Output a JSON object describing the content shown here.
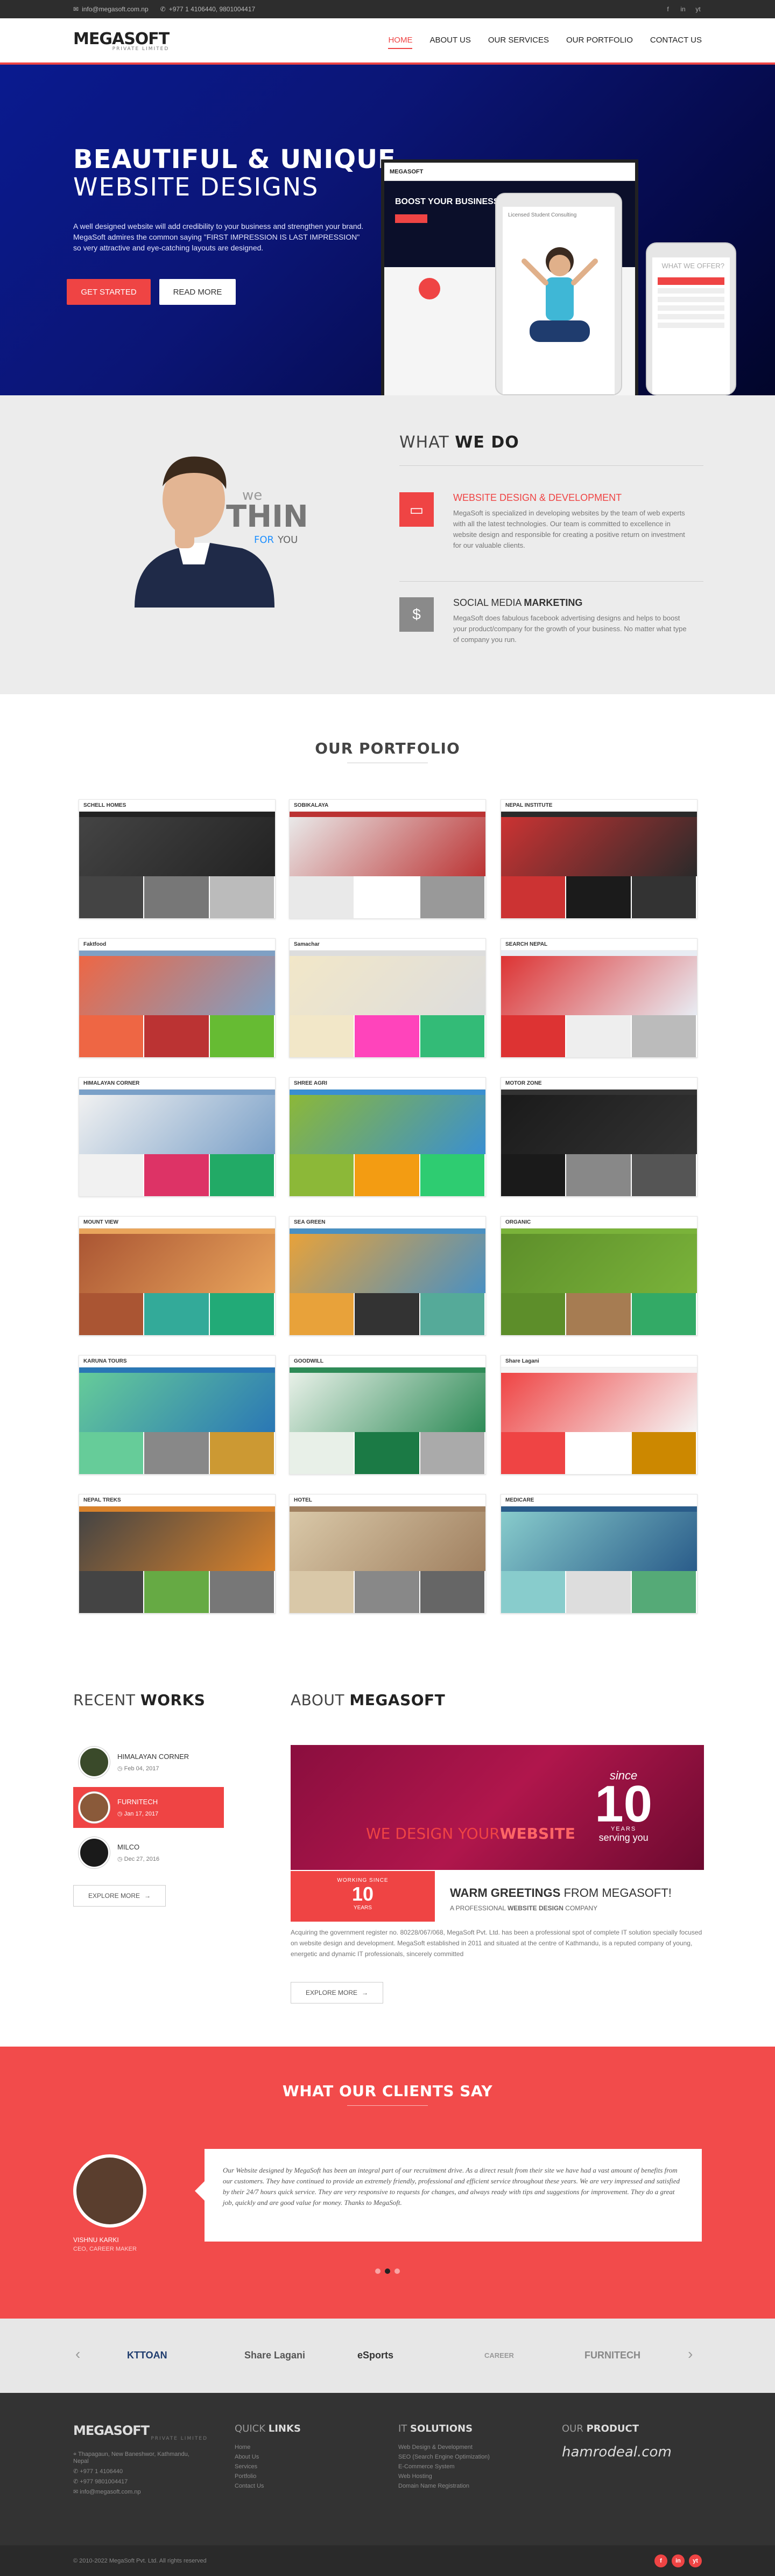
{
  "topbar": {
    "email": "info@megasoft.com.np",
    "phone": "+977 1 4106440, 9801004417",
    "social": [
      "f",
      "in",
      "yt"
    ]
  },
  "nav": {
    "logo_main": "MEGASOFT",
    "logo_sub": "PRIVATE LIMITED",
    "items": [
      "HOME",
      "ABOUT US",
      "OUR SERVICES",
      "OUR PORTFOLIO",
      "CONTACT US"
    ],
    "active": "HOME"
  },
  "hero": {
    "title_bold": "BEAUTIFUL & UNIQUE",
    "title_light": "WEBSITE DESIGNS",
    "text": "A well designed website will add credibility to your business and strengthen your brand. MegaSoft admires the common saying \"FIRST IMPRESSION IS LAST IMPRESSION\" so very attractive and eye-catching layouts are designed.",
    "btn_primary": "GET STARTED",
    "btn_secondary": "READ MORE",
    "laptop_heading": "BOOST YOUR BUSINESS WITH MEGASOFT",
    "laptop_logo": "MEGASOFT",
    "tablet_label": "Licensed Student Consulting",
    "phone_title": "WHAT WE OFFER?"
  },
  "whatwe": {
    "title_light": "WHAT",
    "title_bold": "WE DO",
    "think_we": "we",
    "think_big": "THINK",
    "think_for": "FOR",
    "think_you": "YOU",
    "items": [
      {
        "title_red": "WEBSITE DESIGN",
        "title_rest": "& DEVELOPMENT",
        "text": "MegaSoft is specialized in developing websites by the team of web experts with all the latest technologies. Our team is committed to excellence in website design and responsible for creating a positive return on investment for our valuable clients.",
        "icon": "monitor-icon",
        "color": "#ef4444"
      },
      {
        "title_red": "SOCIAL MEDIA",
        "title_rest": "MARKETING",
        "text": "MegaSoft does fabulous facebook advertising designs and helps to boost your product/company for the growth of your business. No matter what type of company you run.",
        "icon": "dollar-icon",
        "color": "#8a8a8a"
      }
    ]
  },
  "portfolio": {
    "title": "OUR PORTFOLIO",
    "items": [
      {
        "label": "SCHELL HOMES",
        "colors": [
          "#222",
          "#444",
          "#777",
          "#bbb"
        ]
      },
      {
        "label": "SOBIKALAYA",
        "colors": [
          "#b33",
          "#e9e9e9",
          "#fff",
          "#999"
        ]
      },
      {
        "label": "NEPAL INSTITUTE",
        "colors": [
          "#2a2a2a",
          "#c33",
          "#1b1b1b",
          "#333"
        ]
      },
      {
        "label": "Faktfood",
        "colors": [
          "#7fa0c4",
          "#e64",
          "#b33",
          "#6b3"
        ]
      },
      {
        "label": "Samachar",
        "colors": [
          "#ddd",
          "#f2e7c8",
          "#f4b",
          "#3b7"
        ]
      },
      {
        "label": "SEARCH NEPAL",
        "colors": [
          "#e8ecf3",
          "#d33",
          "#eee",
          "#bbb"
        ]
      },
      {
        "label": "HIMALAYAN CORNER",
        "colors": [
          "#7aa0c8",
          "#f1f1f1",
          "#d36",
          "#2a6"
        ]
      },
      {
        "label": "SHREE AGRI",
        "colors": [
          "#3a8fd1",
          "#8cb838",
          "#f39c12",
          "#2ecc71"
        ]
      },
      {
        "label": "MOTOR ZONE",
        "colors": [
          "#333",
          "#1a1a1a",
          "#888",
          "#555"
        ]
      },
      {
        "label": "MOUNT VIEW",
        "colors": [
          "#e9a55c",
          "#a53",
          "#3a9",
          "#2a7"
        ]
      },
      {
        "label": "SEA GREEN",
        "colors": [
          "#4a90c2",
          "#e8a23a",
          "#333",
          "#5a9"
        ]
      },
      {
        "label": "ORGANIC",
        "colors": [
          "#7ab33a",
          "#5d8e2a",
          "#a67c52",
          "#3a6"
        ]
      },
      {
        "label": "KARUNA TOURS",
        "colors": [
          "#2a77b5",
          "#6c9",
          "#888",
          "#c93"
        ]
      },
      {
        "label": "GOODWILL",
        "colors": [
          "#2e8b57",
          "#e8f0e8",
          "#1b7a45",
          "#aaa"
        ]
      },
      {
        "label": "Share Lagani",
        "colors": [
          "#f5f5f5",
          "#ef4444",
          "#fff",
          "#c80"
        ]
      },
      {
        "label": "NEPAL TREKS",
        "colors": [
          "#d9822b",
          "#444",
          "#6a4",
          "#777"
        ]
      },
      {
        "label": "HOTEL",
        "colors": [
          "#a08060",
          "#d9c8a8",
          "#888",
          "#666"
        ]
      },
      {
        "label": "MEDICARE",
        "colors": [
          "#2a5c8a",
          "#8cc",
          "#ddd",
          "#5a7"
        ]
      }
    ]
  },
  "recent": {
    "title_light": "RECENT",
    "title_bold": "WORKS",
    "items": [
      {
        "name": "HIMALAYAN CORNER",
        "date": "Feb 04, 2017"
      },
      {
        "name": "FURNITECH",
        "date": "Jan 17, 2017"
      },
      {
        "name": "MILCO",
        "date": "Dec 27, 2016"
      }
    ],
    "explore": "EXPLORE MORE"
  },
  "about": {
    "title_light": "ABOUT",
    "title_bold": "MEGASOFT",
    "banner_we_design": "WE DESIGN YOUR",
    "banner_website": "WEBSITE",
    "banner_since": "since",
    "banner_years": "10",
    "banner_years_label": "YEARS",
    "banner_serving": "serving you",
    "working_since": "WORKING SINCE",
    "working_years": "10",
    "working_label": "YEARS",
    "greeting_main": "WARM GREETINGS",
    "greeting_rest": "FROM MEGASOFT!",
    "tagline_pre": "A PROFESSIONAL",
    "tagline_bold": "WEBSITE DESIGN",
    "tagline_post": "COMPANY",
    "text": "Acquiring the government register no. 80228/067/068, MegaSoft Pvt. Ltd. has been a professional spot of complete IT solution specially focused on website design and development. MegaSoft established in 2011 and situated at the centre of Kathmandu, is a reputed company of young, energetic and dynamic IT professionals, sincerely committed",
    "explore": "EXPLORE MORE"
  },
  "clients": {
    "title_light": "WHAT OUR",
    "title_bold": "CLIENTS SAY",
    "quote": "Our Website designed by MegaSoft has been an integral part of our recruitment drive. As a direct result from their site we have had a vast amount of benefits from our customers. They have continued to provide an extremely friendly, professional and efficient service throughout these years. We are very impressed and satisfied by their 24/7 hours quick service. They are very responsive to requests for changes, and always ready with tips and suggestions for improvement. They do a great job, quickly and are good value for money. Thanks to MegaSoft.",
    "name": "VISHNU KARKI",
    "role": "CEO, CAREER MAKER",
    "dots": 3,
    "active_dot": 2
  },
  "partners": {
    "items": [
      "KTTOAN",
      "Share Lagani",
      "eSports",
      "CAREER",
      "FURNITECH"
    ]
  },
  "footer": {
    "logo_main": "MEGASOFT",
    "logo_sub": "PRIVATE LIMITED",
    "address": [
      "Thapagaun, New Baneshwor, Kathmandu,",
      "Nepal"
    ],
    "phone1": "+977 1 4106440",
    "phone2": "+977 9801004417",
    "email": "info@megasoft.com.np",
    "quick_light": "QUICK",
    "quick_bold": "LINKS",
    "quick_links": [
      "Home",
      "About Us",
      "Services",
      "Portfolio",
      "Contact Us"
    ],
    "it_light": "IT",
    "it_bold": "SOLUTIONS",
    "it_links": [
      "Web Design & Development",
      "SEO (Search Engine Optimization)",
      "E-Commerce System",
      "Web Hosting",
      "Domain Name Registration"
    ],
    "product_light": "OUR",
    "product_bold": "PRODUCT",
    "product_name": "hamrodeal.com"
  },
  "bottom": {
    "copyright": "© 2010-2022 MegaSoft Pvt. Ltd. All rights reserved",
    "social": [
      "f",
      "in",
      "yt"
    ]
  }
}
